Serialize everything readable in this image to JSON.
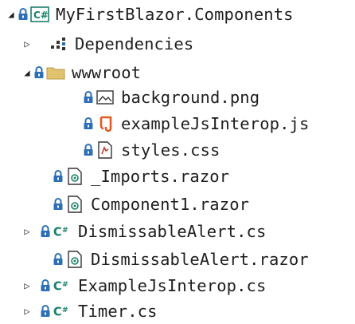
{
  "solution_explorer": {
    "project": {
      "label": "MyFirstBlazor.Components",
      "icon": "csharp-project-icon",
      "expanded": true
    },
    "items": [
      {
        "label": "Dependencies",
        "icon": "dependencies-icon",
        "expandable": true
      },
      {
        "label": "wwwroot",
        "icon": "folder-icon",
        "expanded": true,
        "children": [
          {
            "label": "background.png",
            "icon": "image-file-icon"
          },
          {
            "label": "exampleJsInterop.js",
            "icon": "js-file-icon"
          },
          {
            "label": "styles.css",
            "icon": "css-file-icon"
          }
        ]
      },
      {
        "label": "_Imports.razor",
        "icon": "razor-file-icon"
      },
      {
        "label": "Component1.razor",
        "icon": "razor-file-icon"
      },
      {
        "label": "DismissableAlert.cs",
        "icon": "csharp-file-icon",
        "expandable": true
      },
      {
        "label": "DismissableAlert.razor",
        "icon": "razor-file-icon"
      },
      {
        "label": "ExampleJsInterop.cs",
        "icon": "csharp-file-icon",
        "expandable": true
      },
      {
        "label": "Timer.cs",
        "icon": "csharp-file-icon",
        "expandable": true
      }
    ]
  },
  "colors": {
    "lock": "#2c6fb7",
    "folder": "#e2c36d",
    "js": "#e55a1f",
    "csharp": "#1a7f6b",
    "text": "#1e1e1e"
  }
}
